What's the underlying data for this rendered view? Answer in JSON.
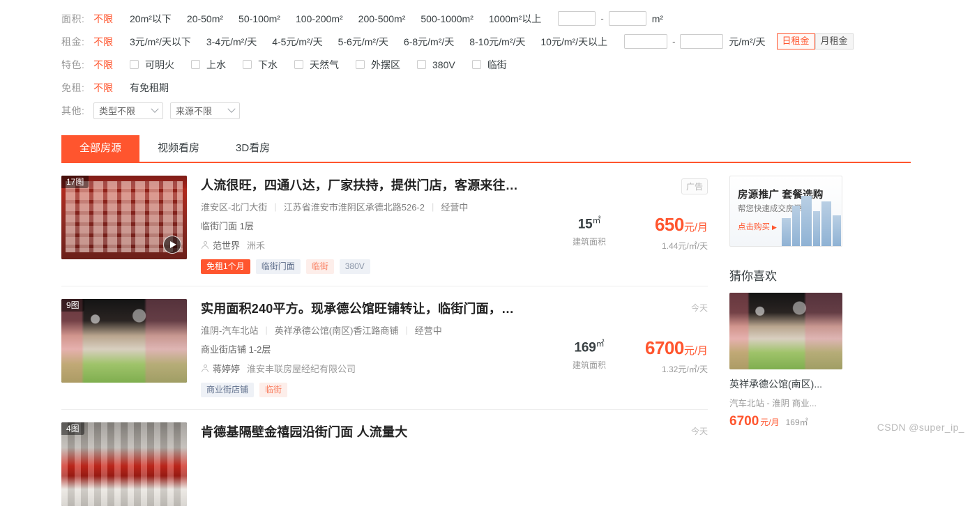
{
  "filters": {
    "rows": [
      {
        "label": "面积:",
        "options": [
          "不限",
          "20m²以下",
          "20-50m²",
          "50-100m²",
          "100-200m²",
          "200-500m²",
          "500-1000m²",
          "1000m²以上"
        ],
        "active_index": 0,
        "range": {
          "min_value": "",
          "max_value": "",
          "dash": "-",
          "unit": "m²"
        }
      },
      {
        "label": "租金:",
        "options": [
          "不限",
          "3元/m²/天以下",
          "3-4元/m²/天",
          "4-5元/m²/天",
          "5-6元/m²/天",
          "6-8元/m²/天",
          "8-10元/m²/天",
          "10元/m²/天以上"
        ],
        "active_index": 0,
        "range": {
          "min_value": "",
          "max_value": "",
          "dash": "-",
          "unit": "元/m²/天"
        },
        "segments": [
          {
            "label": "日租金",
            "selected": true
          },
          {
            "label": "月租金",
            "selected": false
          }
        ]
      }
    ],
    "feature_row": {
      "label": "特色:",
      "unlimited": "不限",
      "checkboxes": [
        {
          "label": "可明火",
          "checked": false
        },
        {
          "label": "上水",
          "checked": false
        },
        {
          "label": "下水",
          "checked": false
        },
        {
          "label": "天然气",
          "checked": false
        },
        {
          "label": "外摆区",
          "checked": false
        },
        {
          "label": "380V",
          "checked": false
        },
        {
          "label": "临街",
          "checked": false
        }
      ]
    },
    "free_rent_row": {
      "label": "免租:",
      "options": [
        "不限",
        "有免租期"
      ],
      "active_index": 0
    },
    "other_row": {
      "label": "其他:",
      "selects": [
        {
          "name": "type-select",
          "value": "类型不限"
        },
        {
          "name": "source-select",
          "value": "来源不限"
        }
      ]
    }
  },
  "tabs": [
    {
      "label": "全部房源",
      "active": true
    },
    {
      "label": "视频看房",
      "active": false
    },
    {
      "label": "3D看房",
      "active": false
    }
  ],
  "listings": [
    {
      "image_badge": "17图",
      "has_video": true,
      "title": "人流很旺，四通八达，厂家扶持，提供门店，客源来往…",
      "district": "淮安区-北门大街",
      "address": "江苏省淮安市淮阴区承德北路526-2",
      "status": "经营中",
      "property_line": "临街门面 1层",
      "agent_name": "范世界",
      "agent_company": "洲禾",
      "tags": [
        {
          "text": "免租1个月",
          "style": "solid"
        },
        {
          "text": "临街门面",
          "style": "blue"
        },
        {
          "text": "临街",
          "style": "pink"
        },
        {
          "text": "380V",
          "style": "gray"
        }
      ],
      "area": "15",
      "area_unit": "㎡",
      "area_caption": "建筑面积",
      "price": "650",
      "price_unit": "元/月",
      "price_per": "1.44元/㎡/天",
      "corner_badge": "广告",
      "corner_boxed": true
    },
    {
      "image_badge": "9图",
      "has_video": false,
      "title": "实用面积240平方。现承德公馆旺铺转让，临街门面，…",
      "district": "淮阴-汽车北站",
      "address": "英祥承德公馆(南区)香江路商铺",
      "status": "经营中",
      "property_line": "商业街店铺 1-2层",
      "agent_name": "蒋婷婷",
      "agent_company": "淮安丰联房屋经纪有限公司",
      "tags": [
        {
          "text": "商业街店铺",
          "style": "blue"
        },
        {
          "text": "临街",
          "style": "pink"
        }
      ],
      "area": "169",
      "area_unit": "㎡",
      "area_caption": "建筑面积",
      "price": "6700",
      "price_unit": "元/月",
      "price_per": "1.32元/㎡/天",
      "corner_badge": "今天",
      "corner_boxed": false
    },
    {
      "image_badge": "4图",
      "has_video": false,
      "title": "肯德基隔壁金禧园沿街门面 人流量大",
      "corner_badge": "今天",
      "corner_boxed": false
    }
  ],
  "sidebar": {
    "ad": {
      "title": "房源推广 套餐选购",
      "subtitle": "帮您快速成交房源",
      "cta": "点击购买",
      "cta_arrow": "▶"
    },
    "recommend_title": "猜你喜欢",
    "recommend": {
      "name": "英祥承德公馆(南区)...",
      "sub": "汽车北站 -  淮阴  商业...",
      "price": "6700",
      "price_unit": "元/月",
      "area": "169㎡"
    }
  },
  "watermark": "CSDN @super_ip_"
}
